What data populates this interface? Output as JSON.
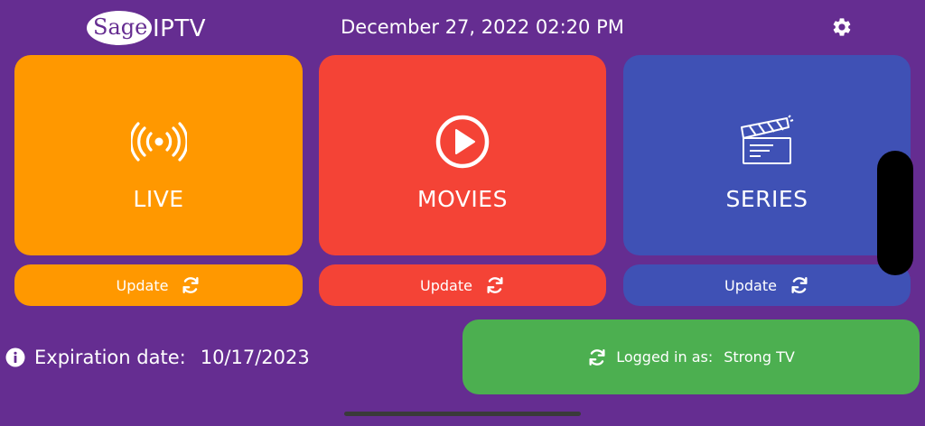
{
  "app": {
    "logo": {
      "sage": "Sage",
      "iptv": "IPTV"
    },
    "datetime": "December 27, 2022 02:20 PM"
  },
  "icons": {
    "settings": "gear-icon",
    "live": "broadcast-icon",
    "movies": "play-circle-icon",
    "series": "clapperboard-icon",
    "refresh": "refresh-icon",
    "info": "info-icon"
  },
  "categories": [
    {
      "label": "LIVE",
      "update_label": "Update",
      "color": "#FF9800"
    },
    {
      "label": "MOVIES",
      "update_label": "Update",
      "color": "#F44336"
    },
    {
      "label": "SERIES",
      "update_label": "Update",
      "color": "#3F51B5"
    }
  ],
  "expiration": {
    "label": "Expiration date:",
    "value": "10/17/2023"
  },
  "login": {
    "label": "Logged in as:",
    "user": "Strong TV",
    "color": "#4CAF50"
  },
  "colors": {
    "background": "#652D91"
  }
}
